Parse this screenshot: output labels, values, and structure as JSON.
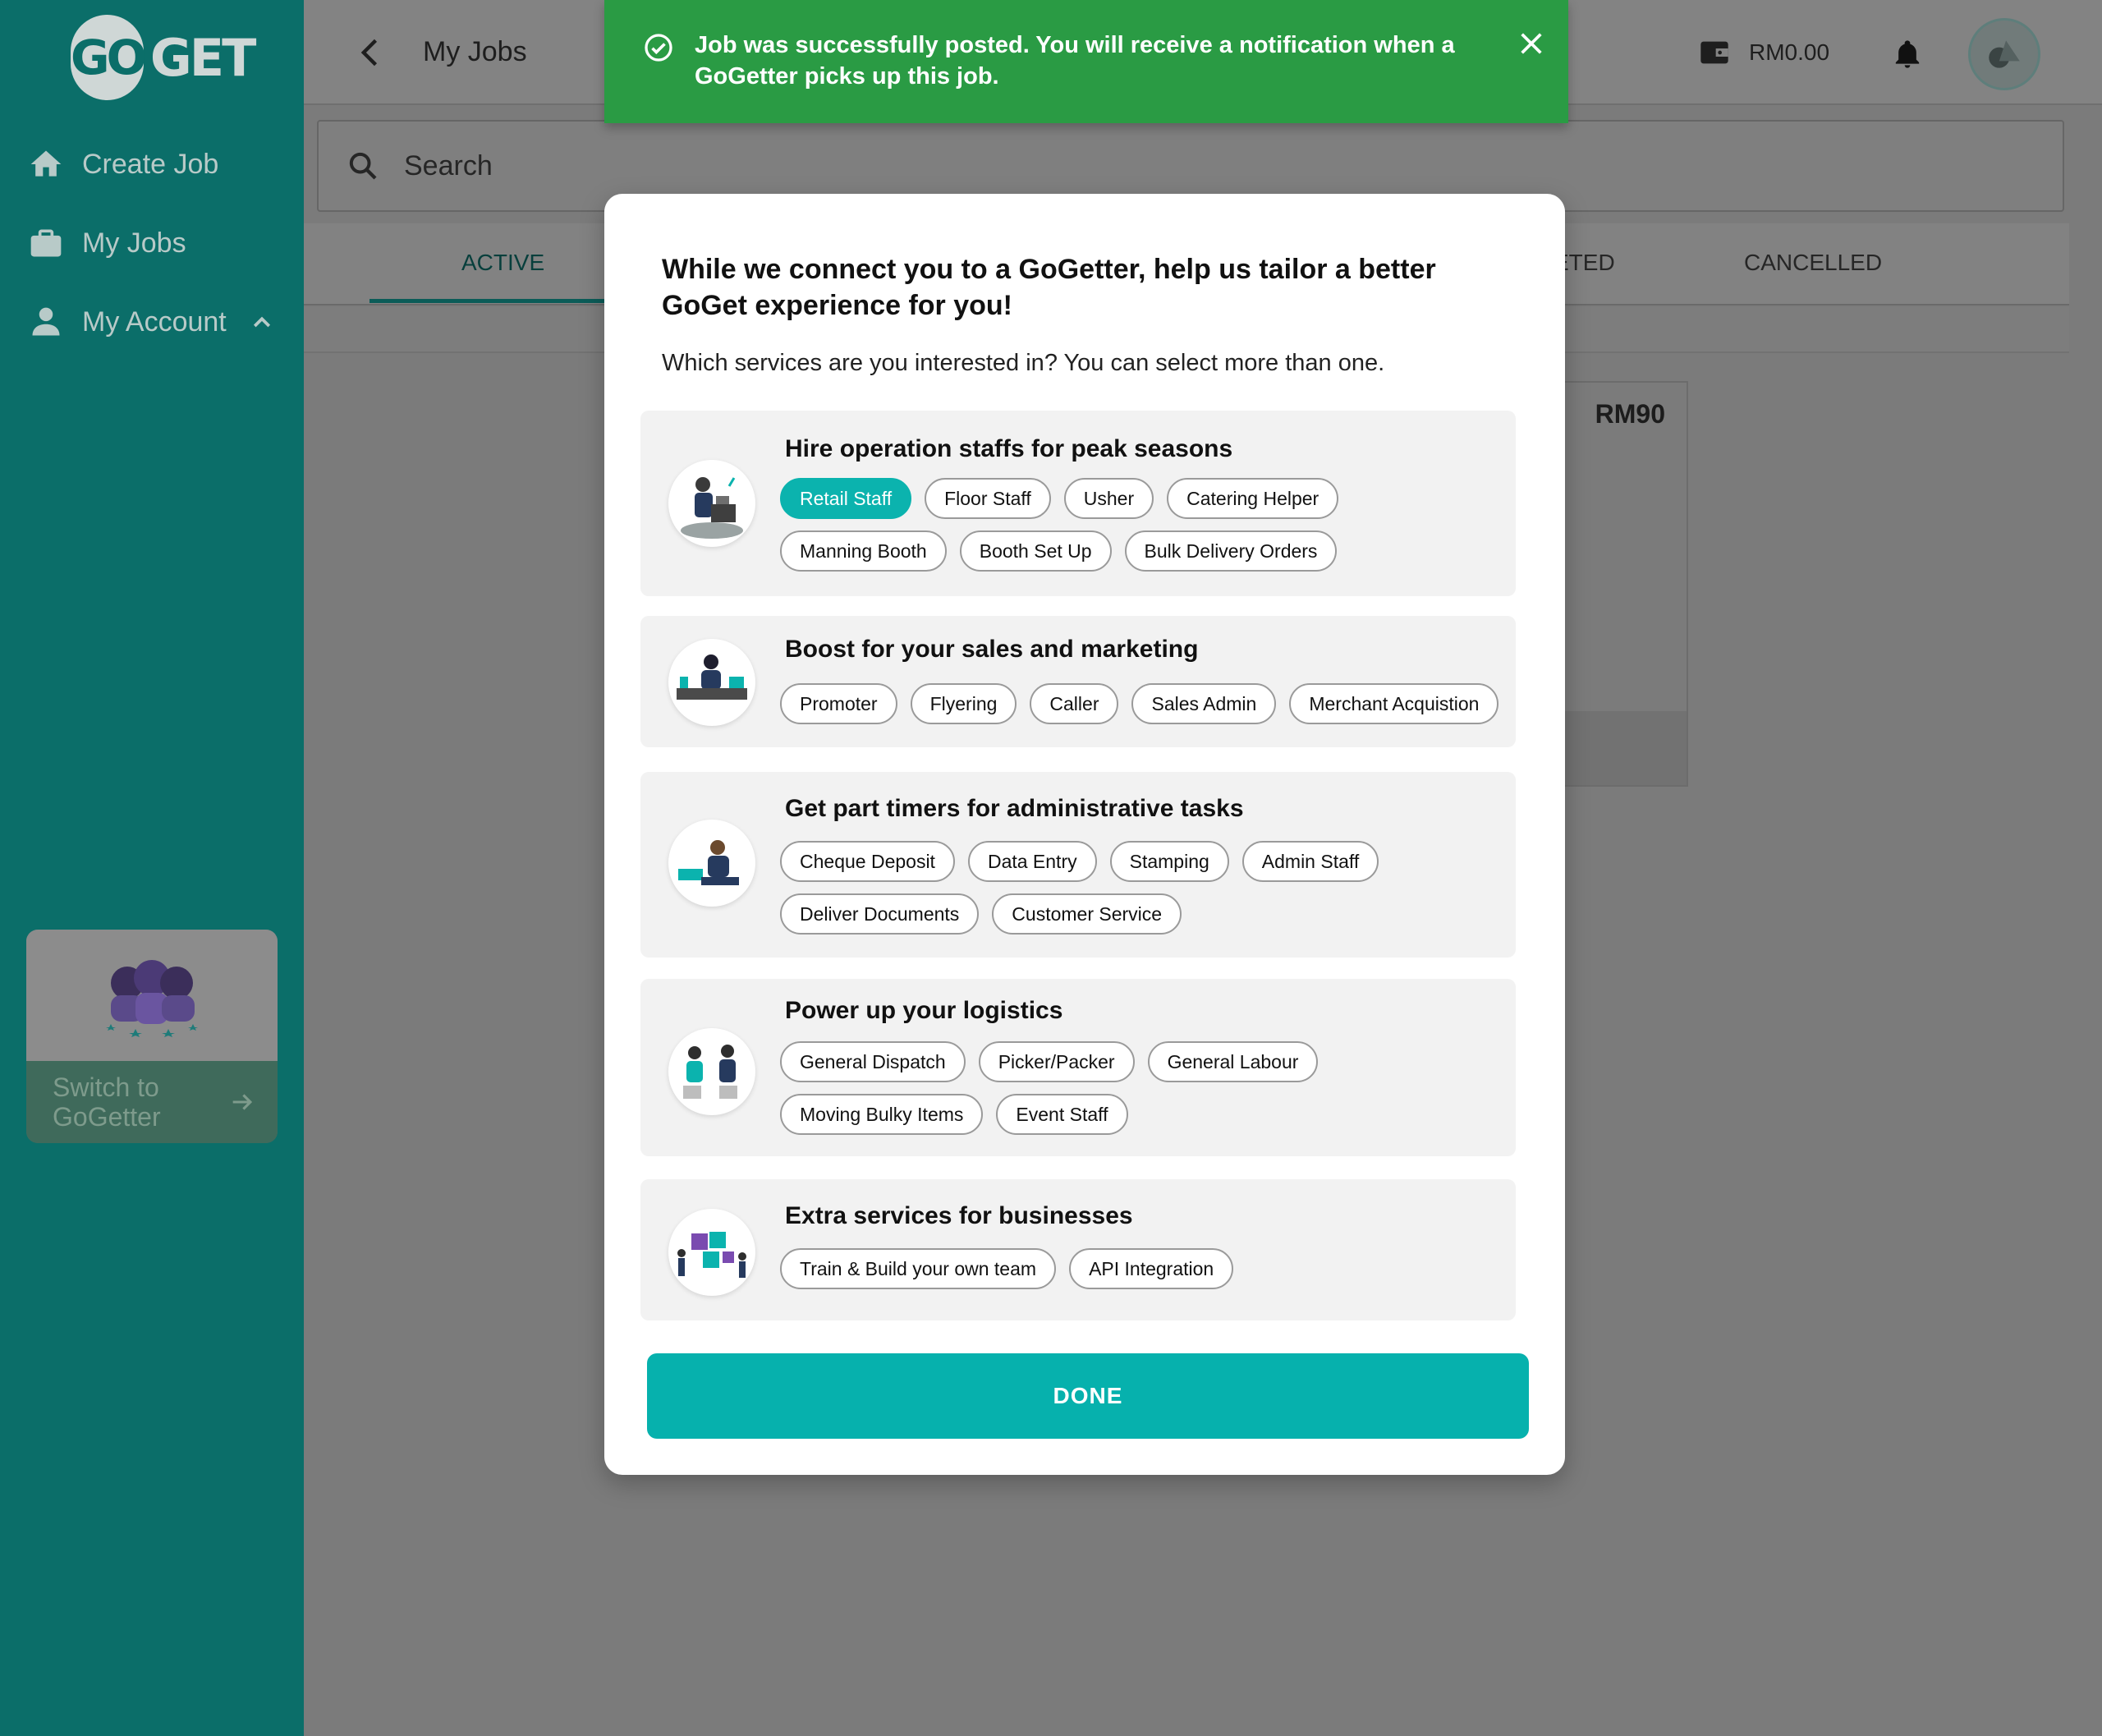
{
  "brand": {
    "logo_left": "GO",
    "logo_right": "GET"
  },
  "sidebar": {
    "items": [
      {
        "label": "Create Job",
        "icon": "home-icon"
      },
      {
        "label": "My Jobs",
        "icon": "briefcase-icon"
      },
      {
        "label": "My Account",
        "icon": "person-icon"
      }
    ],
    "switch_label": "Switch to GoGetter"
  },
  "header": {
    "title": "My Jobs",
    "balance": "RM0.00"
  },
  "search": {
    "placeholder": "Search"
  },
  "tabs": [
    "ACTIVE",
    "ETED",
    "CANCELLED"
  ],
  "job_card": {
    "price": "RM90"
  },
  "toast": {
    "message": "Job was successfully posted. You will receive a notification when a GoGetter picks up this job."
  },
  "modal": {
    "title": "While we connect you to a GoGetter, help us tailor a better GoGet experience for you!",
    "subtitle": "Which services are you interested in? You can select more than one.",
    "sections": [
      {
        "title": "Hire operation staffs for peak seasons",
        "chips": [
          "Retail Staff",
          "Floor Staff",
          "Usher",
          "Catering Helper",
          "Manning Booth",
          "Booth Set Up",
          "Bulk Delivery Orders"
        ],
        "selected": [
          "Retail Staff"
        ]
      },
      {
        "title": "Boost for your sales and marketing",
        "chips": [
          "Promoter",
          "Flyering",
          "Caller",
          "Sales Admin",
          "Merchant Acquistion"
        ],
        "selected": []
      },
      {
        "title": "Get part timers for administrative tasks",
        "chips": [
          "Cheque Deposit",
          "Data Entry",
          "Stamping",
          "Admin Staff",
          "Deliver Documents",
          "Customer Service"
        ],
        "selected": []
      },
      {
        "title": "Power up your logistics",
        "chips": [
          "General Dispatch",
          "Picker/Packer",
          "General Labour",
          "Moving Bulky Items",
          "Event Staff"
        ],
        "selected": []
      },
      {
        "title": "Extra services for businesses",
        "chips": [
          "Train & Build your own team",
          "API Integration"
        ],
        "selected": []
      }
    ],
    "done_label": "DONE"
  },
  "colors": {
    "sidebar": "#0b6e69",
    "accent": "#06b1ad",
    "toast": "#2a9b44",
    "overlay": "#7b7b7b"
  }
}
